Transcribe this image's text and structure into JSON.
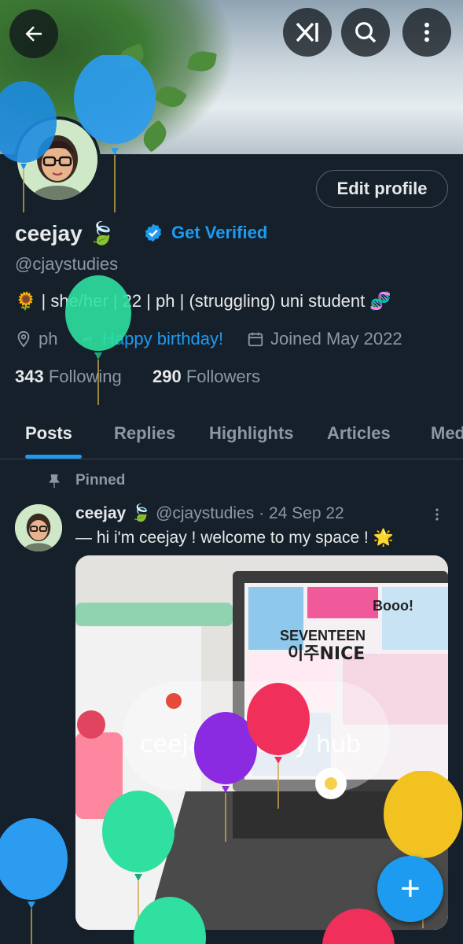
{
  "header": {
    "back_icon": "arrow-left-icon",
    "grok_icon": "grok-icon",
    "search_icon": "search-icon",
    "more_icon": "more-vertical-icon"
  },
  "profile": {
    "display_name": "ceejay",
    "name_emoji": "🍃",
    "get_verified": "Get Verified",
    "handle": "@cjaystudies",
    "bio": "🌻 | she/her | 22 | ph | (struggling) uni student 🧬",
    "location": "ph",
    "website": "Happy birthday!",
    "joined": "Joined May 2022",
    "following_count": "343",
    "following_label": "Following",
    "followers_count": "290",
    "followers_label": "Followers",
    "edit_profile_label": "Edit profile"
  },
  "tabs": [
    {
      "label": "Posts",
      "active": true
    },
    {
      "label": "Replies"
    },
    {
      "label": "Highlights"
    },
    {
      "label": "Articles"
    },
    {
      "label": "Media"
    }
  ],
  "pinned_post": {
    "pinned_label": "Pinned",
    "author": "ceejay",
    "author_emoji": "🍃",
    "handle": "@cjaystudies",
    "separator": "·",
    "date": "24 Sep 22",
    "text": "— hi i'm ceejay ! welcome to my space ! 🌟",
    "image_caption": "ceejay's study hub",
    "laptop_text_1": "SEVENTEEN",
    "laptop_text_2": "이주NICE",
    "laptop_text_3": "Booo!"
  },
  "fab_label": "+",
  "colors": {
    "background": "#15202b",
    "accent": "#1d9bf0",
    "secondary_text": "#8b98a5"
  }
}
